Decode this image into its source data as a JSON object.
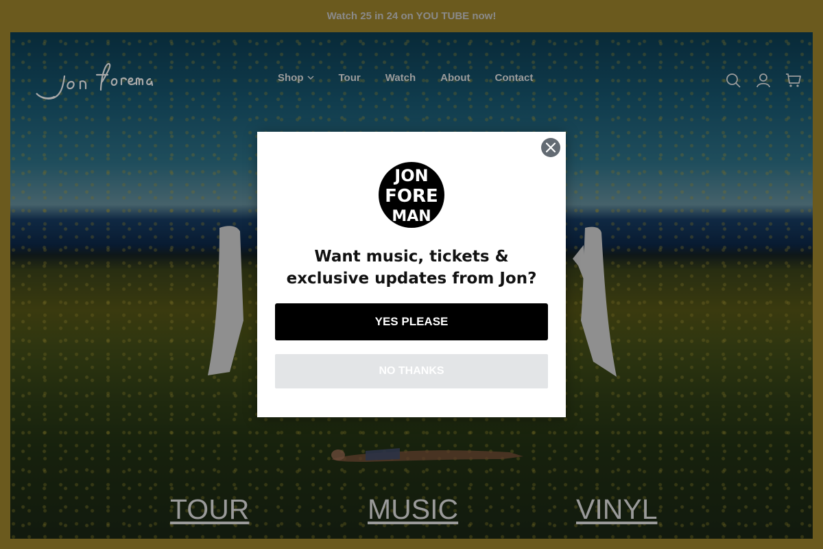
{
  "announcement": {
    "text": "Watch 25 in 24 on YOU TUBE now!"
  },
  "header": {
    "logo_text": "Jon Foreman",
    "nav": [
      {
        "label": "Shop",
        "has_dropdown": true
      },
      {
        "label": "Tour"
      },
      {
        "label": "Watch"
      },
      {
        "label": "About"
      },
      {
        "label": "Contact"
      }
    ],
    "icons": [
      "search-icon",
      "account-icon",
      "cart-icon"
    ]
  },
  "hero": {
    "links": [
      "TOUR",
      "MUSIC",
      "VINYL"
    ]
  },
  "modal": {
    "logo_text": [
      "JON",
      "FORE",
      "MAN"
    ],
    "heading": "Want music, tickets & exclusive updates from Jon?",
    "yes_label": "YES PLEASE",
    "no_label": "NO THANKS"
  },
  "colors": {
    "page_border": "#6b5a1e",
    "primary_button": "#000000",
    "secondary_button": "#e3e5e7",
    "close_button": "#636b73"
  }
}
